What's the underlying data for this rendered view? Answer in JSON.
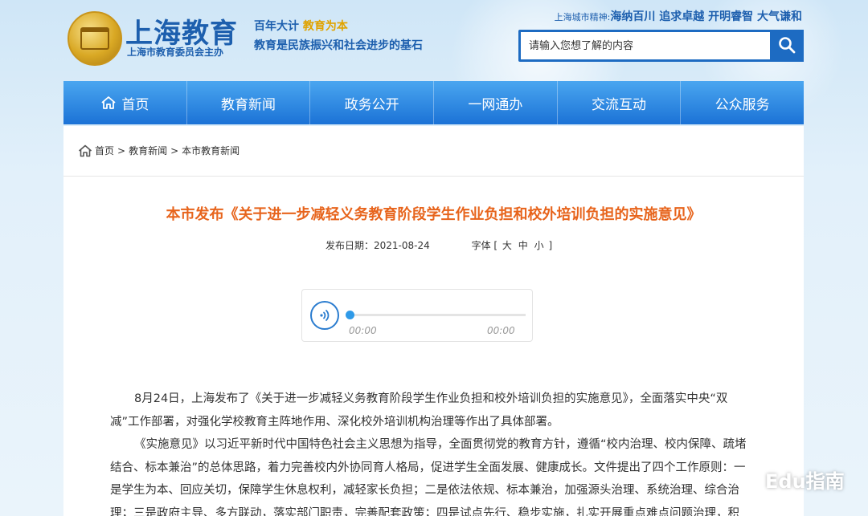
{
  "header": {
    "logo_title": "上海教育",
    "logo_sub": "上海市教育委员会主办",
    "slogan_part1": "百年大计 ",
    "slogan_part2": "教育为本",
    "slogan_line2": "教育是民族振兴和社会进步的基石",
    "spirit_label": "上海城市精神:",
    "spirit_text": "海纳百川 追求卓越 开明睿智 大气谦和",
    "search_placeholder": "请输入您想了解的内容"
  },
  "nav": {
    "items": [
      "首页",
      "教育新闻",
      "政务公开",
      "一网通办",
      "交流互动",
      "公众服务"
    ]
  },
  "breadcrumb": {
    "home": "首页",
    "sep": ">",
    "level1": "教育新闻",
    "level2": "本市教育新闻"
  },
  "article": {
    "title": "本市发布《关于进一步减轻义务教育阶段学生作业负担和校外培训负担的实施意见》",
    "date_label": "发布日期：",
    "date": "2021-08-24",
    "font_label": "字体 [",
    "font_large": "大",
    "font_medium": "中",
    "font_small": "小",
    "font_end": "]",
    "paragraphs": [
      "8月24日，上海发布了《关于进一步减轻义务教育阶段学生作业负担和校外培训负担的实施意见》，全面落实中央“双减”工作部署，对强化学校教育主阵地作用、深化校外培训机构治理等作出了具体部署。",
      "《实施意见》以习近平新时代中国特色社会主义思想为指导，全面贯彻党的教育方针，遵循“校内治理、校内保障、疏堵结合、标本兼治”的总体思路，着力完善校内外协同育人格局，促进学生全面发展、健康成长。文件提出了四个工作原则：一是学生为本、回应关切，保障学生休息权利，减轻家长负担；二是依法依规、标本兼治，加强源头治理、系统治理、综合治理；三是政府主导、多方联动，落实部门职责，完善配套政策；四是试点先行、稳步实施，扎实开展重点难点问题治理，积"
    ]
  },
  "audio": {
    "current_time": "00:00",
    "duration": "00:00",
    "progress": 0
  },
  "watermark": {
    "text": "Edu指南"
  },
  "colors": {
    "brand_blue": "#1d5fae",
    "nav_blue": "#1b72d6",
    "title_orange": "#e7641c"
  }
}
